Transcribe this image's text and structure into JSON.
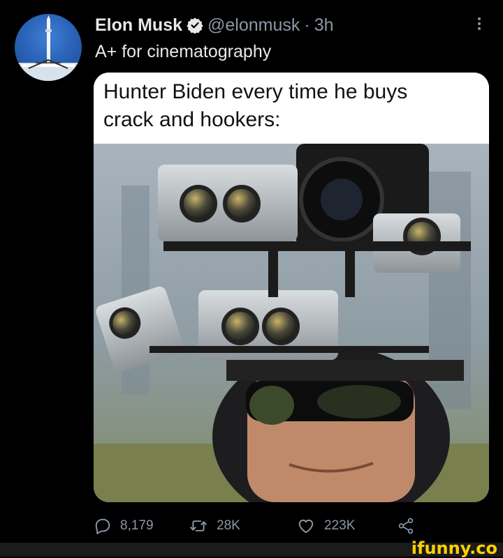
{
  "tweet": {
    "author_name": "Elon Musk",
    "handle": "@elonmusk",
    "separator": "·",
    "time": "3h",
    "text": "A+ for cinematography"
  },
  "media": {
    "caption_line1": "Hunter Biden every time he buys",
    "caption_line2": "crack and hookers:"
  },
  "actions": {
    "replies": "8,179",
    "retweets": "28K",
    "likes": "223K"
  },
  "watermark": "ifunny.co",
  "icons": {
    "verified": "verified-badge-icon",
    "more": "more-options-icon",
    "reply": "reply-icon",
    "retweet": "retweet-icon",
    "like": "heart-icon",
    "share": "share-icon"
  },
  "colors": {
    "background": "#000000",
    "text": "#e7e9ea",
    "secondary": "#8b98a5",
    "watermark": "#ffd100"
  }
}
